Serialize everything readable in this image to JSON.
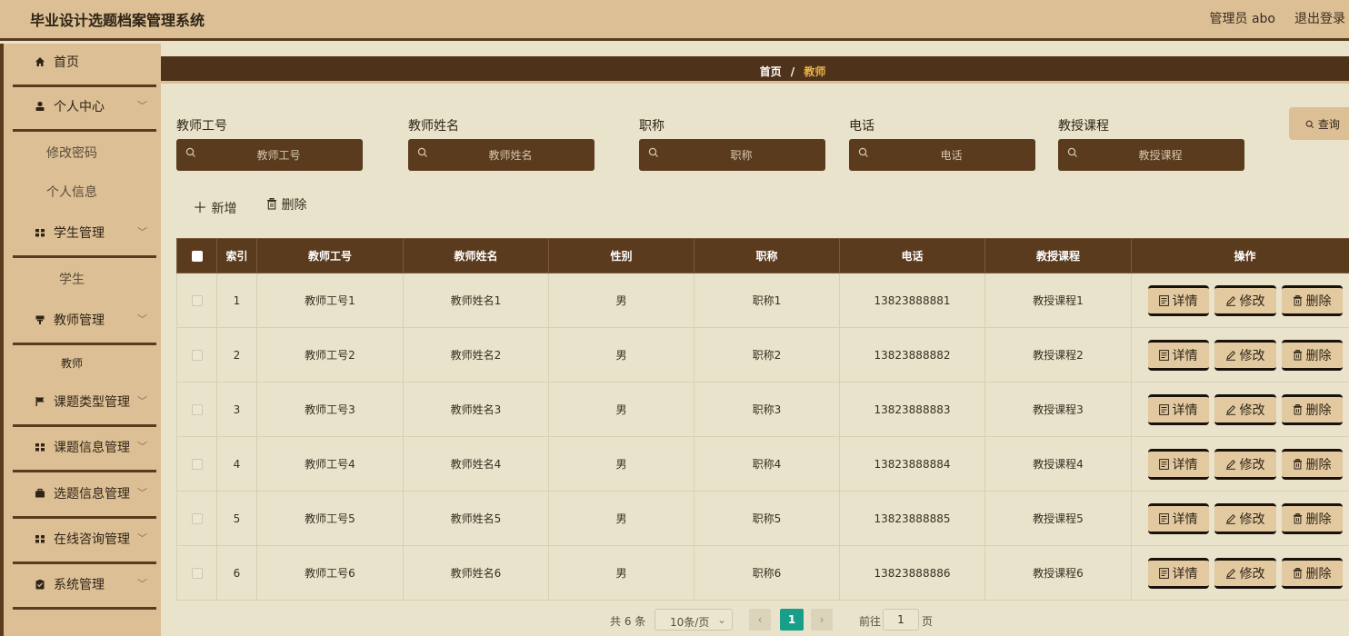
{
  "header": {
    "title": "毕业设计选题档案管理系统",
    "user": "管理员 abo",
    "logout": "退出登录"
  },
  "sidebar": {
    "items": [
      {
        "label": "首页",
        "icon": "home-icon"
      },
      {
        "label": "个人中心",
        "icon": "user-icon",
        "subs": [
          "修改密码",
          "个人信息"
        ]
      },
      {
        "label": "学生管理",
        "icon": "grid-icon",
        "subs": [
          "学生"
        ]
      },
      {
        "label": "教师管理",
        "icon": "podium-icon",
        "subs": [
          "教师"
        ]
      },
      {
        "label": "课题类型管理",
        "icon": "flag-icon"
      },
      {
        "label": "课题信息管理",
        "icon": "grid-icon"
      },
      {
        "label": "选题信息管理",
        "icon": "briefcase-icon"
      },
      {
        "label": "在线咨询管理",
        "icon": "grid-icon"
      },
      {
        "label": "系统管理",
        "icon": "clipboard-icon"
      }
    ]
  },
  "breadcrumb": {
    "home": "首页",
    "sep": "/",
    "current": "教师"
  },
  "filters": [
    {
      "label": "教师工号",
      "placeholder": "教师工号"
    },
    {
      "label": "教师姓名",
      "placeholder": "教师姓名"
    },
    {
      "label": "职称",
      "placeholder": "职称"
    },
    {
      "label": "电话",
      "placeholder": "电话"
    },
    {
      "label": "教授课程",
      "placeholder": "教授课程"
    }
  ],
  "query_label": "查询",
  "actions": {
    "add": "新增",
    "delete": "删除"
  },
  "table": {
    "columns": [
      "索引",
      "教师工号",
      "教师姓名",
      "性别",
      "职称",
      "电话",
      "教授课程",
      "操作"
    ],
    "rows": [
      [
        "1",
        "教师工号1",
        "教师姓名1",
        "男",
        "职称1",
        "13823888881",
        "教授课程1"
      ],
      [
        "2",
        "教师工号2",
        "教师姓名2",
        "男",
        "职称2",
        "13823888882",
        "教授课程2"
      ],
      [
        "3",
        "教师工号3",
        "教师姓名3",
        "男",
        "职称3",
        "13823888883",
        "教授课程3"
      ],
      [
        "4",
        "教师工号4",
        "教师姓名4",
        "男",
        "职称4",
        "13823888884",
        "教授课程4"
      ],
      [
        "5",
        "教师工号5",
        "教师姓名5",
        "男",
        "职称5",
        "13823888885",
        "教授课程5"
      ],
      [
        "6",
        "教师工号6",
        "教师姓名6",
        "男",
        "职称6",
        "13823888886",
        "教授课程6"
      ]
    ],
    "row_buttons": {
      "detail": "详情",
      "edit": "修改",
      "delete": "删除"
    }
  },
  "pagination": {
    "total": "共 6 条",
    "page_size": "10条/页",
    "current_page": "1",
    "goto_prefix": "前往",
    "goto_value": "1",
    "goto_suffix": "页"
  },
  "colors": {
    "header_bg": "#dcbf95",
    "dark_brown": "#5a3b1e",
    "content_bg": "#e9e3cc",
    "accent_gold": "#e8b54a",
    "pager_active": "#199e8a"
  }
}
